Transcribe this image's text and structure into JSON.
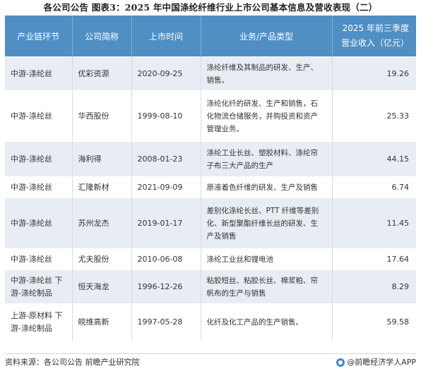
{
  "title": "各公司公告  图表3：2025 年中国涤纶纤维行业上市公司基本信息及营收表现（二）",
  "table": {
    "headers": {
      "chain": "产业链环节",
      "company": "公司简称",
      "listed": "上市时间",
      "business": "业务/产品类型",
      "rev_line1": "2025 年前三季度",
      "rev_line2": "营业收入（亿元）"
    },
    "rows": [
      {
        "chain": "中游-涤纶丝",
        "company": "优彩资源",
        "listed": "2020-09-25",
        "business": "涤纶纤维及其制品的研发、生产、销售。",
        "revenue": "19.26"
      },
      {
        "chain": "中游-涤纶丝",
        "company": "华西股份",
        "listed": "1999-08-10",
        "business": "涤纶化纤的研发、生产和销售，石化物流仓储服务，并购投资和资产管理业务。",
        "revenue": "25.33"
      },
      {
        "chain": "中游-涤纶丝",
        "company": "海利得",
        "listed": "2008-01-23",
        "business": "涤纶工业长丝、塑胶材料、涤纶帘子布三大产品的生产",
        "revenue": "44.15"
      },
      {
        "chain": "中游-涤纶丝",
        "company": "汇隆新材",
        "listed": "2021-09-09",
        "business": "原液着色纤维的研发、生产及销售",
        "revenue": "6.74"
      },
      {
        "chain": "中游-涤纶丝",
        "company": "苏州龙杰",
        "listed": "2019-01-17",
        "business": "差别化涤纶长丝、PTT 纤维等差别化、新型聚酯纤维长丝的研发、生产及销售",
        "revenue": "11.45"
      },
      {
        "chain": "中游-涤纶丝",
        "company": "尤夫股份",
        "listed": "2010-06-08",
        "business": "涤纶工业丝和锂电池",
        "revenue": "17.64"
      },
      {
        "chain": "中游-涤纶丝 下游-涤纶制品",
        "company": "恒天海龙",
        "listed": "1996-12-26",
        "business": "粘胶短丝、粘胶长丝、棉浆粕、帘帆布的生产与销售",
        "revenue": "8.29"
      },
      {
        "chain": "上游-原材料 下游-涤纶制品",
        "company": "皖维高新",
        "listed": "1997-05-28",
        "business": "化纤及化工产品的生产销售。",
        "revenue": "59.58"
      }
    ]
  },
  "footer": {
    "source": "资料来源：各公司公告 前瞻产业研究院",
    "brand": "@前瞻经济学人APP"
  }
}
